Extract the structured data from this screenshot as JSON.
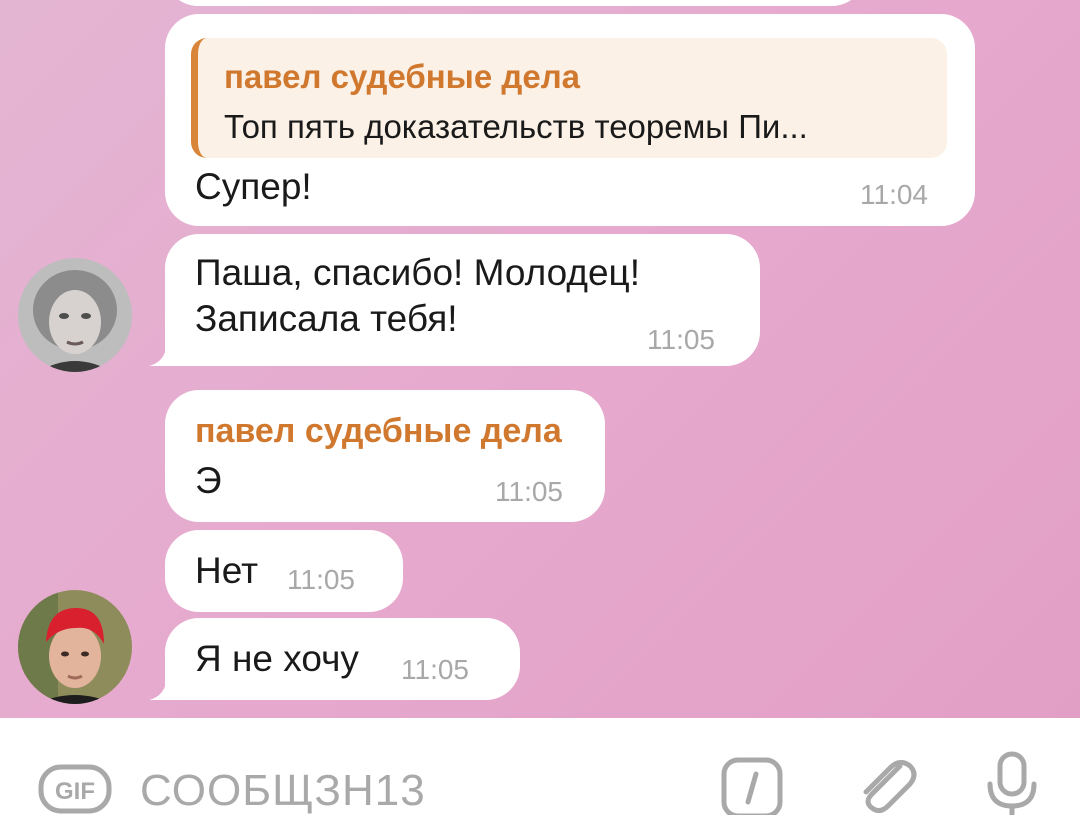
{
  "messages": [
    {
      "reply": {
        "name": "павел судебные дела",
        "text": "Топ пять доказательств теоремы Пи..."
      },
      "text": "Супер!",
      "time": "11:04"
    },
    {
      "text": "Паша, спасибо! Молодец!\nЗаписала тебя!",
      "time": "11:05"
    },
    {
      "sender": "павел судебные дела",
      "text": "Э",
      "time": "11:05"
    },
    {
      "text": "Нет",
      "time": "11:05"
    },
    {
      "text": "Я не хочу",
      "time": "11:05"
    }
  ],
  "composer": {
    "placeholder": "СООБЩЗН13",
    "gif_label": "GIF"
  },
  "icons": {
    "gif": "gif-icon",
    "sticker": "sticker-icon",
    "attach": "paperclip-icon",
    "mic": "microphone-icon"
  },
  "colors": {
    "sender_name": "#d1782f",
    "reply_bar": "#d8853a",
    "time": "#a8a8a8",
    "background_start": "#e4b5d3",
    "background_end": "#e29fc6"
  }
}
